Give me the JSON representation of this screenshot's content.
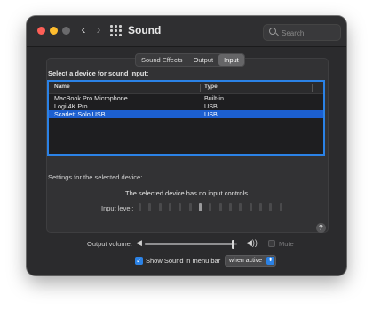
{
  "window": {
    "title": "Sound",
    "back_glyph": "‹",
    "forward_glyph": "›",
    "search_placeholder": "Search"
  },
  "tabs": [
    {
      "label": "Sound Effects",
      "active": false
    },
    {
      "label": "Output",
      "active": false
    },
    {
      "label": "Input",
      "active": true
    }
  ],
  "input": {
    "select_label": "Select a device for sound input:",
    "columns": [
      "Name",
      "Type"
    ],
    "devices": [
      {
        "name": "MacBook Pro Microphone",
        "type": "Built-in",
        "selected": false
      },
      {
        "name": "Logi 4K Pro",
        "type": "USB",
        "selected": false
      },
      {
        "name": "Scarlett Solo USB",
        "type": "USB",
        "selected": true
      }
    ],
    "settings_label": "Settings for the selected device:",
    "no_controls_text": "The selected device has no input controls",
    "input_level_label": "Input level:",
    "input_level_segments": 15,
    "input_level_lit_index": 6
  },
  "help_glyph": "?",
  "output": {
    "volume_label": "Output volume:",
    "volume_low_icon": "speaker-low-icon",
    "volume_high_icon": "speaker-high-icon",
    "volume_fraction": 0.96,
    "mute_label": "Mute",
    "mute_checked": false,
    "show_in_menubar_label": "Show Sound in menu bar",
    "show_in_menubar_checked": true,
    "menubar_option": "when active"
  },
  "colors": {
    "accent": "#2b82e6",
    "selected_row": "#1c5fd0",
    "window_bg": "#2b2b2d"
  }
}
